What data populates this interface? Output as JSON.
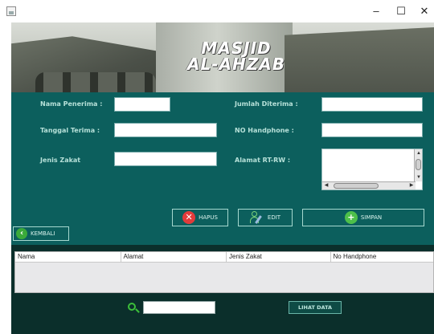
{
  "window": {
    "minimize_glyph": "–",
    "maximize_glyph": "☐",
    "close_glyph": "✕"
  },
  "banner": {
    "title_line1": "MASJID",
    "title_line2": "AL-AHZAB"
  },
  "form": {
    "nama_penerima_label": "Nama Penerima :",
    "tanggal_terima_label": "Tanggal Terima :",
    "jenis_zakat_label": "Jenis Zakat",
    "jumlah_diterima_label": "Jumlah Diterima :",
    "no_handphone_label": "NO Handphone :",
    "alamat_label": "Alamat RT-RW :",
    "nama_penerima_value": "",
    "tanggal_terima_value": "",
    "jenis_zakat_value": "",
    "jumlah_diterima_value": "",
    "no_handphone_value": "",
    "alamat_value": ""
  },
  "buttons": {
    "hapus": "HAPUS",
    "edit": "EDIT",
    "simpan": "SIMPAN",
    "kembali": "KEMBALI",
    "lihat_data": "LIHAT DATA"
  },
  "icons": {
    "hapus": "x-circle-icon",
    "edit": "user-edit-icon",
    "simpan": "plus-circle-icon",
    "kembali": "back-arrow-icon",
    "search": "search-icon"
  },
  "table": {
    "columns": [
      "Nama",
      "Alamat",
      "Jenis Zakat",
      "No Handphone"
    ],
    "rows": []
  },
  "search": {
    "value": ""
  },
  "colors": {
    "panel": "#0c5f5d",
    "table_panel": "#0b2f2b",
    "hapus_red": "#e23b3b",
    "simpan_green": "#4ec04a"
  }
}
